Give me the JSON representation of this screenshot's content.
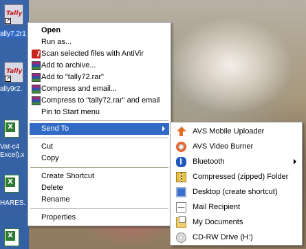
{
  "desktop": {
    "icons": [
      {
        "label": "ally7.2r1",
        "kind": "tally",
        "selected": true
      },
      {
        "label": "ally9r2.",
        "kind": "tally",
        "selected": false
      },
      {
        "label": "Vat-c4",
        "label2": "Excel).x",
        "kind": "excel",
        "selected": false
      },
      {
        "label": "HARES.",
        "kind": "excel",
        "selected": false
      }
    ]
  },
  "context_menu": {
    "items": [
      {
        "label": "Open",
        "bold": true,
        "icon": ""
      },
      {
        "label": "Run as...",
        "icon": ""
      },
      {
        "label": "Scan selected files with AntiVir",
        "icon": "antivir-icon"
      },
      {
        "label": "Add to archive...",
        "icon": "winrar-icon"
      },
      {
        "label": "Add to \"tally72.rar\"",
        "icon": "winrar-icon"
      },
      {
        "label": "Compress and email...",
        "icon": "winrar-icon"
      },
      {
        "label": "Compress to \"tally72.rar\" and email",
        "icon": "winrar-icon"
      },
      {
        "label": "Pin to Start menu",
        "icon": ""
      },
      {
        "label": "Send To",
        "icon": "",
        "highlighted": true,
        "submenu": true
      },
      {
        "label": "Cut",
        "icon": ""
      },
      {
        "label": "Copy",
        "icon": ""
      },
      {
        "label": "Create Shortcut",
        "icon": ""
      },
      {
        "label": "Delete",
        "icon": ""
      },
      {
        "label": "Rename",
        "icon": ""
      },
      {
        "label": "Properties",
        "icon": ""
      }
    ]
  },
  "send_to_menu": {
    "items": [
      {
        "label": "AVS Mobile Uploader",
        "icon": "upload-arrow-icon"
      },
      {
        "label": "AVS Video Burner",
        "icon": "disc-burner-icon"
      },
      {
        "label": "Bluetooth",
        "icon": "bluetooth-icon",
        "submenu": true
      },
      {
        "label": "Compressed (zipped) Folder",
        "icon": "zip-folder-icon"
      },
      {
        "label": "Desktop (create shortcut)",
        "icon": "desktop-icon"
      },
      {
        "label": "Mail Recipient",
        "icon": "mail-icon"
      },
      {
        "label": "My Documents",
        "icon": "documents-folder-icon"
      },
      {
        "label": "CD-RW Drive (H:)",
        "icon": "cd-drive-icon"
      }
    ]
  },
  "colors": {
    "highlight": "#316ac5",
    "menu_bg": "#ffffff",
    "separator": "#aca899"
  }
}
